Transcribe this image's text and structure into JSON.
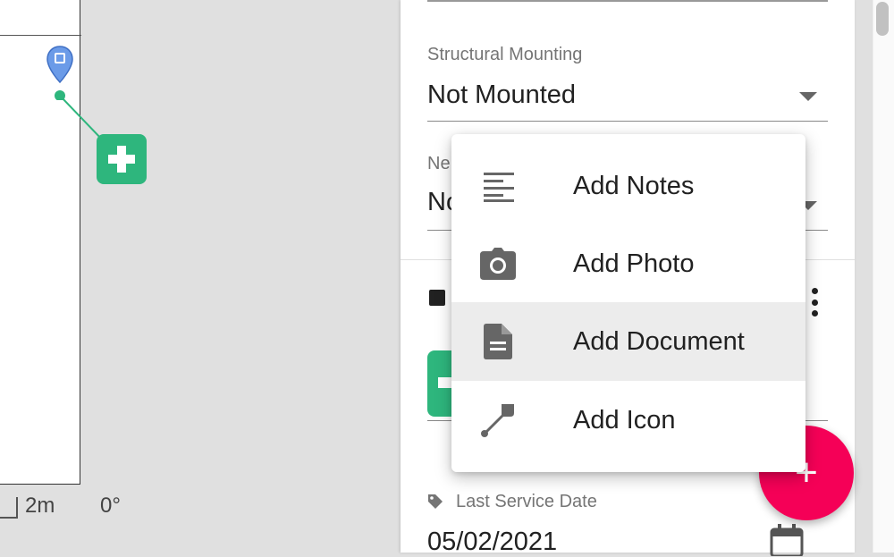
{
  "map": {
    "scale_label": "2m",
    "rotation_label": "0°"
  },
  "panel": {
    "structural_mounting": {
      "label": "Structural Mounting",
      "value": "Not Mounted"
    },
    "second_field": {
      "label_partial": "Ne",
      "value_partial": "No"
    },
    "last_service_date": {
      "label": "Last Service Date",
      "value": "05/02/2021"
    }
  },
  "menu": {
    "items": [
      {
        "label": "Add Notes",
        "icon": "notes-icon"
      },
      {
        "label": "Add Photo",
        "icon": "camera-icon"
      },
      {
        "label": "Add Document",
        "icon": "document-icon"
      },
      {
        "label": "Add Icon",
        "icon": "pin-line-icon"
      }
    ],
    "hovered_index": 2
  },
  "fab": {
    "label": "+",
    "color": "#f50057"
  },
  "colors": {
    "accent_green": "#2eb67d",
    "pin_blue": "#6b9be8"
  }
}
